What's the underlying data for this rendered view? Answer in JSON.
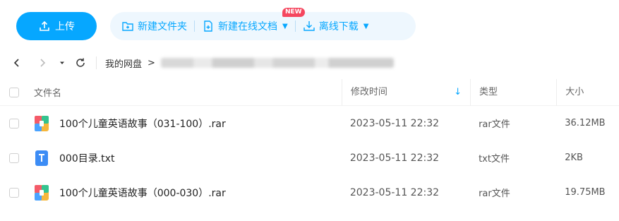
{
  "toolbar": {
    "upload_label": "上传",
    "new_folder_label": "新建文件夹",
    "new_online_doc_label": "新建在线文档",
    "new_badge": "NEW",
    "offline_download_label": "离线下载"
  },
  "breadcrumb": {
    "root": "我的网盘",
    "separator": ">"
  },
  "table": {
    "headers": {
      "name": "文件名",
      "mtime": "修改时间",
      "type": "类型",
      "size": "大小"
    },
    "rows": [
      {
        "name": "100个儿童英语故事（031-100）.rar",
        "mtime": "2023-05-11 22:32",
        "type": "rar文件",
        "size": "36.12MB",
        "icon": "archive-icon"
      },
      {
        "name": "000目录.txt",
        "mtime": "2023-05-11 22:32",
        "type": "txt文件",
        "size": "2KB",
        "icon": "text-file-icon"
      },
      {
        "name": "100个儿童英语故事（000-030）.rar",
        "mtime": "2023-05-11 22:32",
        "type": "rar文件",
        "size": "19.75MB",
        "icon": "archive-icon"
      }
    ]
  },
  "colors": {
    "accent": "#06a7ff",
    "badge": "#f5465e",
    "tool_bg": "#eef7fe"
  }
}
